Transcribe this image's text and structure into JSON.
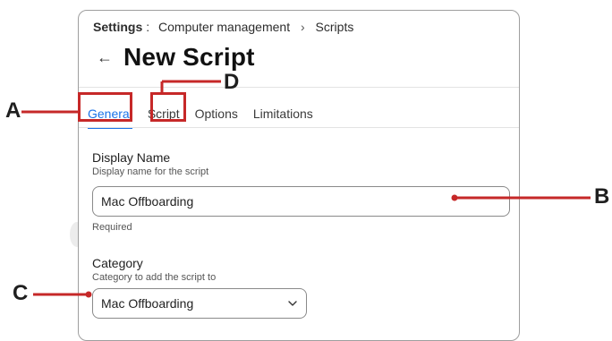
{
  "breadcrumb": {
    "root": "Settings",
    "separator": ":",
    "section": "Computer management",
    "chevron": "›",
    "current": "Scripts"
  },
  "header": {
    "back_icon": "←",
    "title": "New Script"
  },
  "tabs": [
    {
      "label": "General",
      "active": true
    },
    {
      "label": "Script",
      "active": false
    },
    {
      "label": "Options",
      "active": false
    },
    {
      "label": "Limitations",
      "active": false
    }
  ],
  "form": {
    "display_name": {
      "label": "Display Name",
      "help": "Display name for the script",
      "value": "Mac Offboarding",
      "required_note": "Required"
    },
    "category": {
      "label": "Category",
      "help": "Category to add the script to",
      "selected": "Mac Offboarding"
    }
  },
  "callouts": {
    "a": "A",
    "b": "B",
    "c": "C",
    "d": "D"
  },
  "colors": {
    "accent": "#1a73e8",
    "callout": "#c62828"
  }
}
